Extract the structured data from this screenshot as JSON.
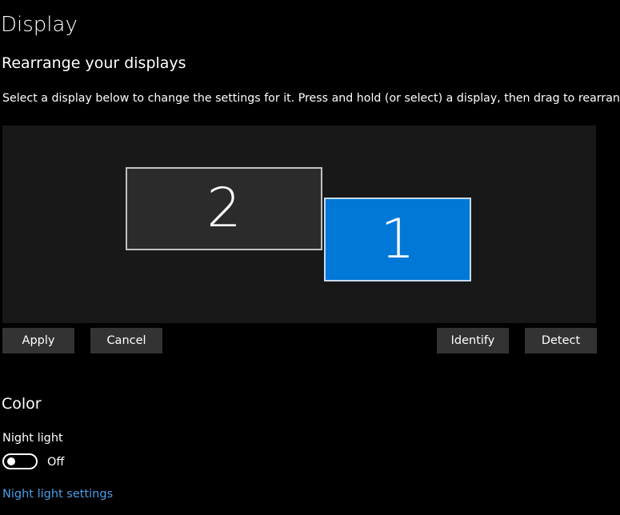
{
  "page": {
    "title": "Display"
  },
  "rearrange": {
    "heading": "Rearrange your displays",
    "instructions": "Select a display below to change the settings for it. Press and hold (or select) a display, then drag to rearrange it.",
    "displays": [
      {
        "number": "1",
        "selected": true
      },
      {
        "number": "2",
        "selected": false
      }
    ],
    "buttons": {
      "apply": "Apply",
      "cancel": "Cancel",
      "identify": "Identify",
      "detect": "Detect"
    }
  },
  "color": {
    "heading": "Color",
    "night_light": {
      "label": "Night light",
      "state": "Off",
      "on": false
    },
    "settings_link": "Night light settings"
  },
  "colors": {
    "background": "#000000",
    "display_area": "#181818",
    "selected_display": "#0078d7",
    "unselected_display": "#2b2b2b",
    "button": "#333333",
    "link": "#4a9fe8"
  }
}
